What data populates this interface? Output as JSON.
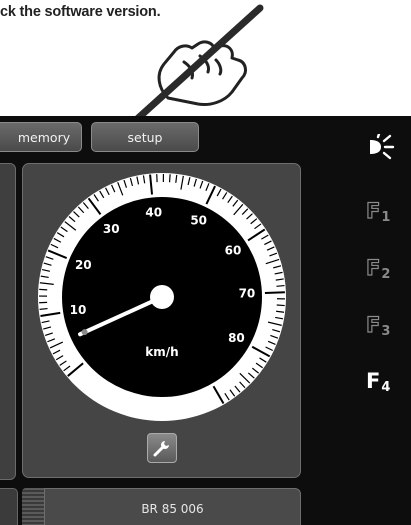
{
  "instruction": {
    "text": "ck the software version."
  },
  "tabs": [
    {
      "label": "memory"
    },
    {
      "label": "setup"
    }
  ],
  "gauge": {
    "unit": "km/h",
    "min": 0,
    "max": 90,
    "major_labels": [
      "10",
      "20",
      "30",
      "40",
      "50",
      "60",
      "70",
      "80"
    ],
    "needle_value": 5,
    "colors": {
      "dial": "#000000",
      "ring": "#ffffff",
      "needle": "#ffffff"
    }
  },
  "loco": {
    "name": "BR 85 006"
  },
  "function_keys": [
    {
      "icon": "headlight-icon",
      "state": "active"
    },
    {
      "letter": "F",
      "number": "1",
      "state": "inactive"
    },
    {
      "letter": "F",
      "number": "2",
      "state": "inactive"
    },
    {
      "letter": "F",
      "number": "3",
      "state": "inactive"
    },
    {
      "letter": "F",
      "number": "4",
      "state": "active"
    }
  ],
  "icons": {
    "settings": "wrench-icon",
    "pointer": "hand-pen-icon"
  }
}
